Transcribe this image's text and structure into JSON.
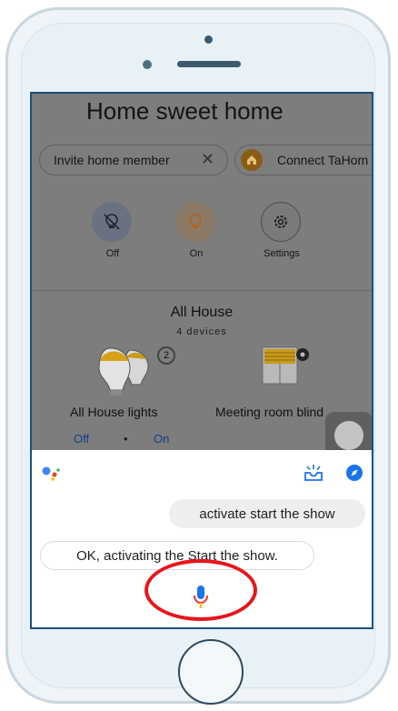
{
  "screen": {
    "title": "Home sweet home",
    "chips": {
      "invite": "Invite home member",
      "connect": "Connect TaHom"
    },
    "quick_actions": {
      "off": "Off",
      "on": "On",
      "settings": "Settings"
    },
    "section": {
      "title": "All House",
      "subtitle": "4 devices"
    },
    "devices": {
      "lights_label": "All House lights",
      "lights_count": "2",
      "blind_label": "Meeting room blind",
      "lights_off": "Off",
      "lights_sep": "•",
      "lights_on": "On"
    }
  },
  "assistant": {
    "user_message": "activate start the show",
    "assistant_reply": "OK, activating the Start the show."
  },
  "colors": {
    "accent_blue": "#1a73e8",
    "highlight_red": "#e8151b",
    "mic_red": "#ea4335"
  },
  "icons": [
    "lightbulb-off-icon",
    "lightbulb-on-icon",
    "gear-icon",
    "house-icon",
    "google-assistant-icon",
    "inbox-icon",
    "compass-icon",
    "microphone-icon",
    "close-icon"
  ]
}
